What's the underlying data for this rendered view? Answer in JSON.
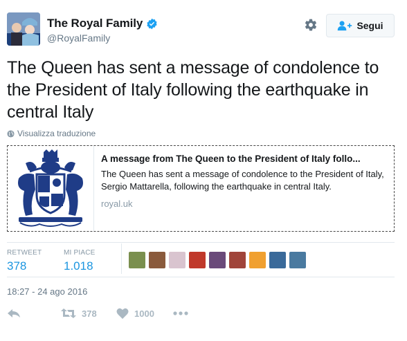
{
  "user": {
    "display_name": "The Royal Family",
    "handle": "@RoyalFamily",
    "verified": true
  },
  "follow_button": {
    "label": "Segui"
  },
  "tweet": {
    "text": "The Queen has sent a message of condolence to the President of Italy following the earthquake in central Italy",
    "translate_label": "Visualizza traduzione"
  },
  "card": {
    "title": "A message from The Queen to the President of Italy follo...",
    "description": "The Queen has sent a message of condolence to the President of Italy, Sergio Mattarella, following the earthquake in central Italy.",
    "domain": "royal.uk"
  },
  "stats": {
    "retweets_label": "RETWEET",
    "retweets_value": "378",
    "likes_label": "MI PIACE",
    "likes_value": "1.018"
  },
  "likers": [
    {
      "name": "liker-1",
      "color": "#7a8f4e"
    },
    {
      "name": "liker-2",
      "color": "#8a5a3c"
    },
    {
      "name": "liker-3",
      "color": "#d9c4cf"
    },
    {
      "name": "liker-4",
      "color": "#c0392b"
    },
    {
      "name": "liker-5",
      "color": "#6a4a7a"
    },
    {
      "name": "liker-6",
      "color": "#a0443a"
    },
    {
      "name": "liker-7",
      "color": "#f0a030"
    },
    {
      "name": "liker-8",
      "color": "#3a6a9a"
    },
    {
      "name": "liker-9",
      "color": "#4a7aa0"
    }
  ],
  "timestamp": "18:27 - 24 ago 2016",
  "actions": {
    "retweet_count": "378",
    "like_count": "1000"
  },
  "colors": {
    "accent": "#1b95e0",
    "muted": "#657786",
    "action_icon": "#aab8c2"
  },
  "icons": {
    "verified": "verified-badge-icon",
    "gear": "gear-icon",
    "follow": "follow-person-icon",
    "globe": "globe-icon",
    "reply": "reply-icon",
    "retweet": "retweet-icon",
    "like": "heart-icon",
    "more": "more-dots-icon"
  }
}
